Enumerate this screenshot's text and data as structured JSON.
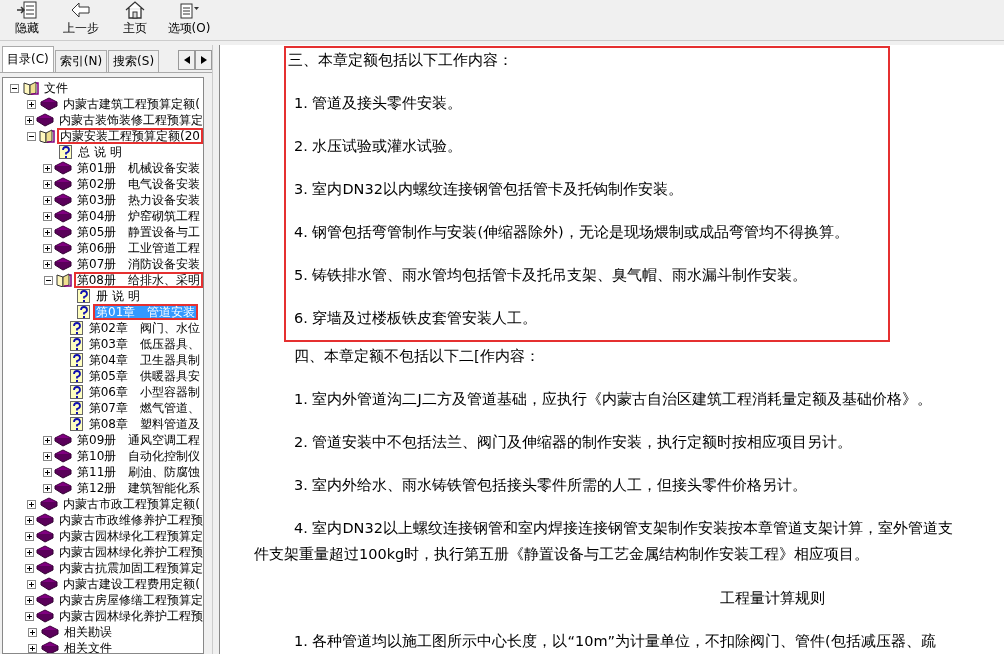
{
  "toolbar": [
    {
      "label": "隐藏",
      "kind": "hide"
    },
    {
      "label": "上一步",
      "kind": "back"
    },
    {
      "label": "主页",
      "kind": "home"
    },
    {
      "label": "选项(O)",
      "kind": "options"
    }
  ],
  "tabs": [
    {
      "label": "目录(C)",
      "selected": true
    },
    {
      "label": "索引(N)",
      "selected": false
    },
    {
      "label": "搜索(S)",
      "selected": false
    }
  ],
  "tree": [
    {
      "label": "文件",
      "kind": "folder",
      "expanded": true,
      "selected": false,
      "marked": false,
      "children": [
        {
          "label": "内蒙古建筑工程预算定额(",
          "kind": "book",
          "expanded": false,
          "selected": false,
          "marked": false
        },
        {
          "label": "内蒙古装饰装修工程预算定",
          "kind": "book",
          "expanded": false,
          "selected": false,
          "marked": false
        },
        {
          "label": "内蒙安装工程预算定额(20",
          "kind": "folder",
          "expanded": true,
          "selected": false,
          "marked": true,
          "children": [
            {
              "label": "总 说 明",
              "kind": "page",
              "selected": false,
              "marked": false
            },
            {
              "label": "第01册　机械设备安装",
              "kind": "book",
              "expanded": false,
              "selected": false,
              "marked": false
            },
            {
              "label": "第02册　电气设备安装",
              "kind": "book",
              "expanded": false,
              "selected": false,
              "marked": false
            },
            {
              "label": "第03册　热力设备安装",
              "kind": "book",
              "expanded": false,
              "selected": false,
              "marked": false
            },
            {
              "label": "第04册　炉窑砌筑工程",
              "kind": "book",
              "expanded": false,
              "selected": false,
              "marked": false
            },
            {
              "label": "第05册　静置设备与工",
              "kind": "book",
              "expanded": false,
              "selected": false,
              "marked": false
            },
            {
              "label": "第06册　工业管道工程",
              "kind": "book",
              "expanded": false,
              "selected": false,
              "marked": false
            },
            {
              "label": "第07册　消防设备安装",
              "kind": "book",
              "expanded": false,
              "selected": false,
              "marked": false
            },
            {
              "label": "第08册　给排水、采明",
              "kind": "folder",
              "expanded": true,
              "selected": false,
              "marked": true,
              "children": [
                {
                  "label": "册 说 明",
                  "kind": "page",
                  "selected": false,
                  "marked": false
                },
                {
                  "label": "第01章　管道安装",
                  "kind": "page",
                  "selected": true,
                  "marked": true
                },
                {
                  "label": "第02章　阀门、水位",
                  "kind": "page",
                  "selected": false,
                  "marked": false
                },
                {
                  "label": "第03章　低压器具、",
                  "kind": "page",
                  "selected": false,
                  "marked": false
                },
                {
                  "label": "第04章　卫生器具制",
                  "kind": "page",
                  "selected": false,
                  "marked": false
                },
                {
                  "label": "第05章　供暖器具安",
                  "kind": "page",
                  "selected": false,
                  "marked": false
                },
                {
                  "label": "第06章　小型容器制",
                  "kind": "page",
                  "selected": false,
                  "marked": false
                },
                {
                  "label": "第07章　燃气管道、",
                  "kind": "page",
                  "selected": false,
                  "marked": false
                },
                {
                  "label": "第08章　塑料管道及",
                  "kind": "page",
                  "selected": false,
                  "marked": false
                }
              ]
            },
            {
              "label": "第09册　通风空调工程",
              "kind": "book",
              "expanded": false,
              "selected": false,
              "marked": false
            },
            {
              "label": "第10册　自动化控制仪",
              "kind": "book",
              "expanded": false,
              "selected": false,
              "marked": false
            },
            {
              "label": "第11册　刷油、防腐蚀",
              "kind": "book",
              "expanded": false,
              "selected": false,
              "marked": false
            },
            {
              "label": "第12册　建筑智能化系",
              "kind": "book",
              "expanded": false,
              "selected": false,
              "marked": false
            }
          ]
        },
        {
          "label": "内蒙古市政工程预算定额(",
          "kind": "book",
          "expanded": false,
          "selected": false,
          "marked": false
        },
        {
          "label": "内蒙古市政维修养护工程预",
          "kind": "book",
          "expanded": false,
          "selected": false,
          "marked": false
        },
        {
          "label": "内蒙古园林绿化工程预算定",
          "kind": "book",
          "expanded": false,
          "selected": false,
          "marked": false
        },
        {
          "label": "内蒙古园林绿化养护工程预",
          "kind": "book",
          "expanded": false,
          "selected": false,
          "marked": false
        },
        {
          "label": "内蒙古抗震加固工程预算定",
          "kind": "book",
          "expanded": false,
          "selected": false,
          "marked": false
        },
        {
          "label": "内蒙古建设工程费用定额(",
          "kind": "book",
          "expanded": false,
          "selected": false,
          "marked": false
        },
        {
          "label": "内蒙古房屋修缮工程预算定",
          "kind": "book",
          "expanded": false,
          "selected": false,
          "marked": false
        },
        {
          "label": "内蒙古园林绿化养护工程预",
          "kind": "book",
          "expanded": false,
          "selected": false,
          "marked": false
        },
        {
          "label": "相关勘误",
          "kind": "book",
          "expanded": false,
          "selected": false,
          "marked": false
        },
        {
          "label": "相关文件",
          "kind": "book",
          "expanded": false,
          "selected": false,
          "marked": false
        }
      ]
    }
  ],
  "sections": [
    {
      "highlighted": true,
      "paragraphs": [
        {
          "kind": "heading",
          "text": "三、本章定额包括以下工作内容："
        },
        {
          "kind": "item",
          "text": "1. 管道及接头零件安装。"
        },
        {
          "kind": "item",
          "text": "2. 水压试验或灌水试验。"
        },
        {
          "kind": "item",
          "text": "3. 室内DN32以内螺纹连接钢管包括管卡及托钩制作安装。"
        },
        {
          "kind": "item",
          "text": "4. 钢管包括弯管制作与安装(伸缩器除外)，无论是现场煨制或成品弯管均不得换算。"
        },
        {
          "kind": "item",
          "text": "5. 铸铁排水管、雨水管均包括管卡及托吊支架、臭气帽、雨水漏斗制作安装。"
        },
        {
          "kind": "item",
          "text": "6. 穿墙及过楼板铁皮套管安装人工。"
        }
      ]
    },
    {
      "highlighted": false,
      "paragraphs": [
        {
          "kind": "item",
          "text": "四、本章定额不包括以下二[作内容："
        },
        {
          "kind": "item",
          "text": "1. 室内外管道沟二J二方及管道基础，应执行《内蒙古自治区建筑工程消耗量定额及基础价格》。"
        },
        {
          "kind": "item",
          "text": "2. 管道安装中不包括法兰、阀门及伸缩器的制作安装，执行定额时按相应项目另计。"
        },
        {
          "kind": "item",
          "text": "3. 室内外给水、雨水铸铁管包括接头零件所需的人工，但接头零件价格另计。"
        },
        {
          "kind": "item",
          "text": "4. 室内DN32以上螺纹连接钢管和室内焊接连接钢管支架制作安装按本章管道支架计算，室外管道支"
        },
        {
          "kind": "continuation",
          "text": "件支架重量超过100kg时，执行第五册《静置设备与工艺金属结构制作安装工程》相应项目。"
        },
        {
          "kind": "center",
          "text": "工程量计算规则"
        },
        {
          "kind": "item",
          "text": "1. 各种管道均以施工图所示中心长度，以“10m”为计量单位，不扣除阀门、管件(包括减压器、疏"
        }
      ]
    }
  ]
}
